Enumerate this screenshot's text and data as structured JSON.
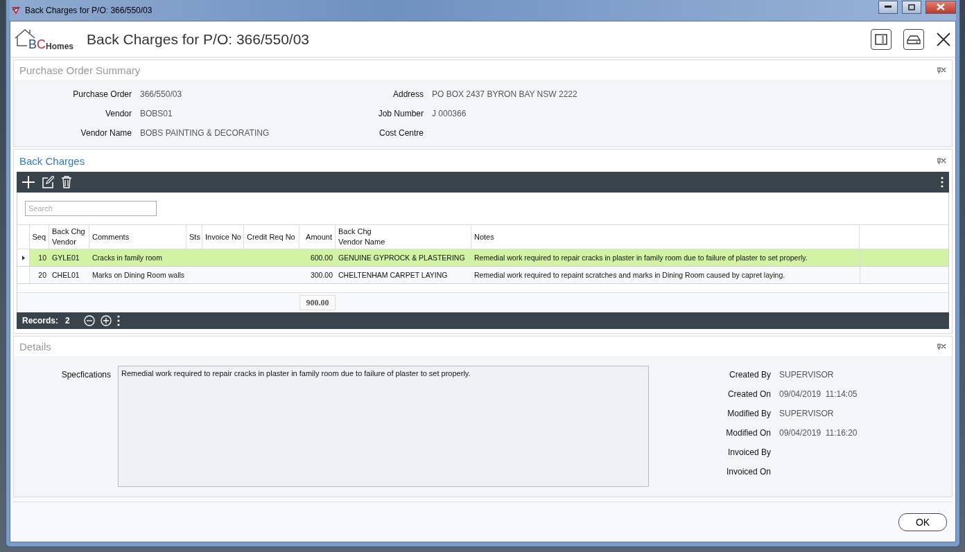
{
  "window": {
    "title": "Back Charges for P/O: 366/550/03"
  },
  "header": {
    "logo_parts": [
      {
        "text": "B",
        "color": "#2e4f8f"
      },
      {
        "text": "C",
        "color": "#d02c3a"
      },
      {
        "text": "Homes",
        "color": "#3a3a3a"
      }
    ],
    "title": "Back Charges for P/O: 366/550/03"
  },
  "summary": {
    "title": "Purchase Order Summary",
    "left": [
      {
        "label": "Purchase Order",
        "value": "366/550/03"
      },
      {
        "label": "Vendor",
        "value": "BOBS01"
      },
      {
        "label": "Vendor Name",
        "value": "BOBS PAINTING & DECORATING"
      }
    ],
    "right": [
      {
        "label": "Address",
        "value": "PO BOX 2437 BYRON BAY NSW 2222"
      },
      {
        "label": "Job Number",
        "value": "J 000366"
      },
      {
        "label": "Cost Centre"
      }
    ]
  },
  "back_charges": {
    "title": "Back Charges",
    "search": {
      "placeholder": "Search"
    },
    "columns": [
      "Seq",
      "Back Chg\nVendor",
      "Comments",
      "Sts",
      "Invoice No",
      "Credit Req No",
      "Amount",
      "Back Chg\nVendor Name",
      "Notes"
    ],
    "rows": [
      {
        "selected": true,
        "cells": [
          "10",
          "GYLE01",
          "Cracks in family room",
          "",
          "",
          "",
          "600.00",
          "GENUINE GYPROCK & PLASTERING",
          "Remedial work required to repair cracks in plaster in family room due to failure of plaster to set properly."
        ]
      },
      {
        "selected": false,
        "cells": [
          "20",
          "CHEL01",
          "Marks on Dining Room walls",
          "",
          "",
          "",
          "300.00",
          "CHELTENHAM CARPET LAYING",
          "Remedial work required to repaint scratches and marks in Dining Room caused by capret laying."
        ]
      }
    ],
    "total": "900.00",
    "records_label": "Records:",
    "records_count": "2"
  },
  "details": {
    "title": "Details",
    "spec_label": "Specfications",
    "spec_value": "Remedial work required to repair cracks in plaster in family room due to failure of plaster to set properly.",
    "audit": [
      {
        "label": "Created By",
        "value": "SUPERVISOR"
      },
      {
        "label": "Created On",
        "value": "09/04/2019  11:14:05"
      },
      {
        "label": "Modified By",
        "value": "SUPERVISOR"
      },
      {
        "label": "Modified On",
        "value": "09/04/2019  11:16:20"
      },
      {
        "label": "Invoiced By"
      },
      {
        "label": "Invoiced On"
      }
    ]
  },
  "buttons": [
    "OK"
  ]
}
